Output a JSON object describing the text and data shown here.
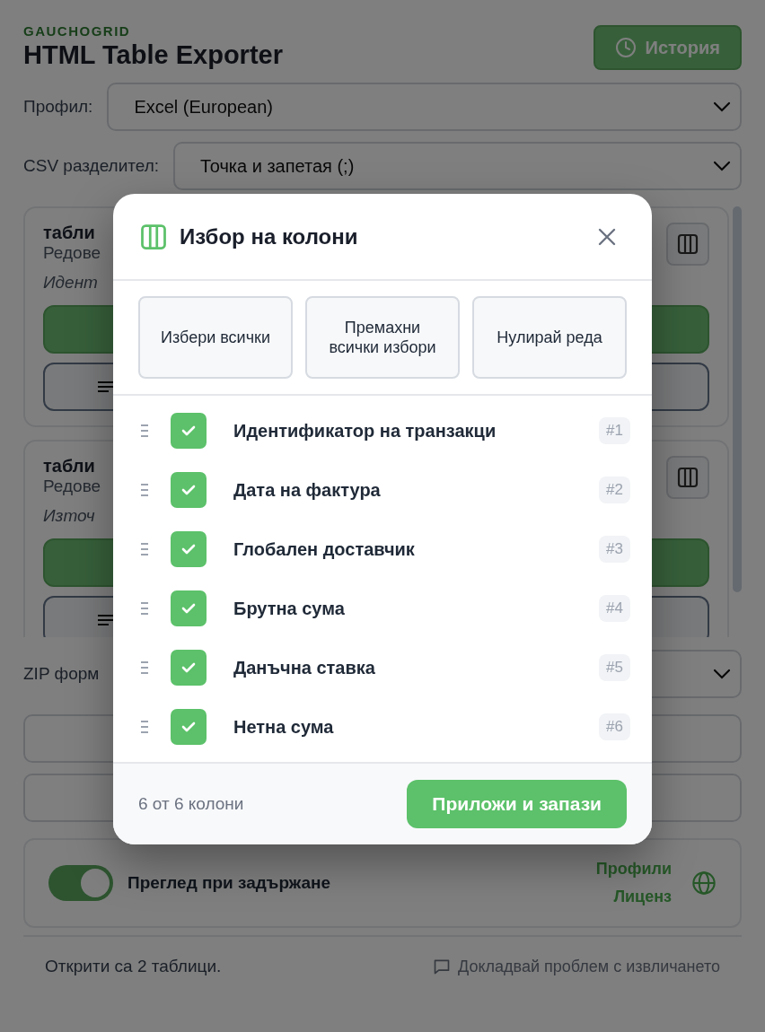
{
  "header": {
    "brand": "GAUCHOGRID",
    "title": "HTML Table Exporter",
    "history_button": "История"
  },
  "profile": {
    "label": "Профил:",
    "value": "Excel (European)"
  },
  "csv": {
    "label": "CSV разделител:",
    "value": "Точка и запетая (;)"
  },
  "tables": [
    {
      "title": "табли",
      "rows": "Редове",
      "columns": "Идент"
    },
    {
      "title": "табли",
      "rows": "Редове",
      "columns": "Източ"
    }
  ],
  "zip": {
    "label": "ZIP форм"
  },
  "hover_preview": {
    "label": "Преглед при задържане",
    "on": true
  },
  "links": [
    "Профили",
    "Лиценз"
  ],
  "footer": {
    "status": "Открити са 2 таблици.",
    "report_link": "Докладвай проблем с извличането"
  },
  "modal": {
    "title": "Избор на колони",
    "actions": [
      "Избери всички",
      "Премахни всички избори",
      "Нулирай реда"
    ],
    "columns": [
      {
        "name": "Идентификатор на транзакци",
        "checked": true,
        "index": "#1"
      },
      {
        "name": "Дата на фактура",
        "checked": true,
        "index": "#2"
      },
      {
        "name": "Глобален доставчик",
        "checked": true,
        "index": "#3"
      },
      {
        "name": "Брутна сума",
        "checked": true,
        "index": "#4"
      },
      {
        "name": "Данъчна ставка",
        "checked": true,
        "index": "#5"
      },
      {
        "name": "Нетна сума",
        "checked": true,
        "index": "#6"
      }
    ],
    "count": "6 от 6 колони",
    "apply": "Приложи и запази"
  }
}
